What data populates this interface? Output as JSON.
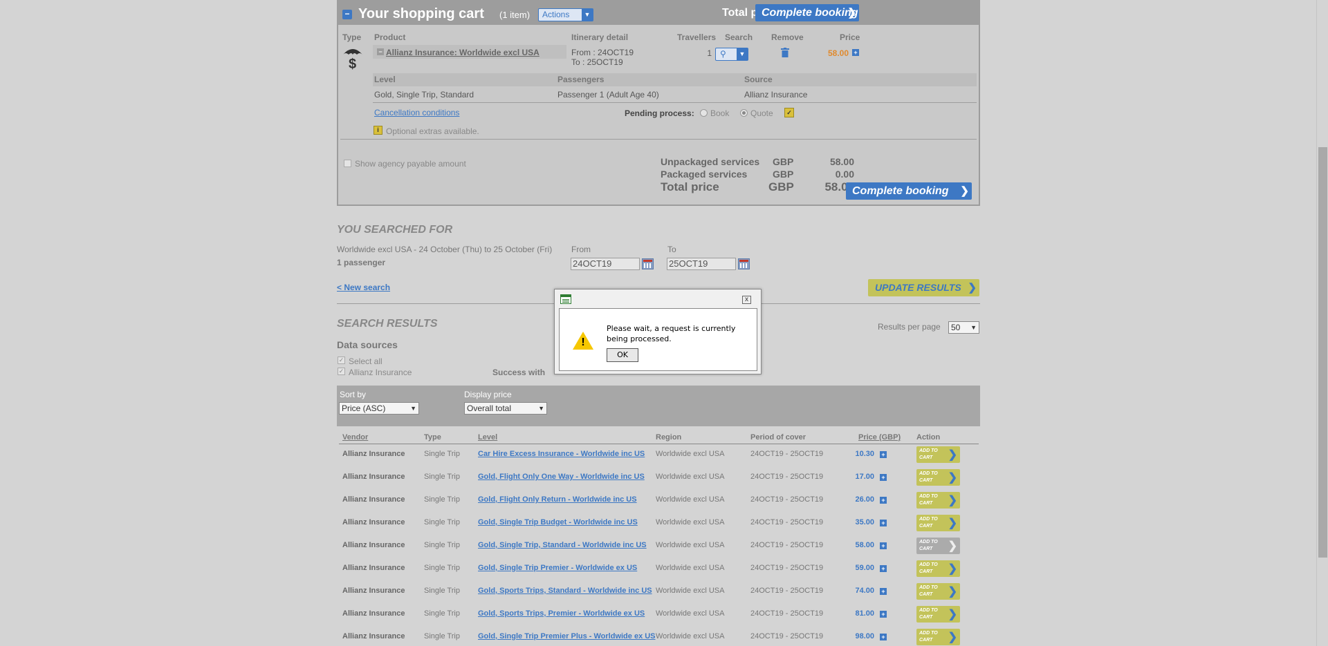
{
  "cart": {
    "collapse": "−",
    "title": "Your shopping cart",
    "count": "(1 item)",
    "actions_label": "Actions",
    "total": "Total price GBP 58.00",
    "complete_label": "Complete booking",
    "headers": {
      "type": "Type",
      "product": "Product",
      "itinerary": "Itinerary detail",
      "travellers": "Travellers",
      "search": "Search",
      "remove": "Remove",
      "price": "Price"
    },
    "item": {
      "product": "Allianz Insurance: Worldwide excl USA",
      "from": "From : 24OCT19",
      "to": "To : 25OCT19",
      "travellers": "1",
      "price": "58.00"
    },
    "sub_headers": {
      "level": "Level",
      "passengers": "Passengers",
      "source": "Source"
    },
    "sub_values": {
      "level": "Gold, Single Trip, Standard",
      "passengers": "Passenger 1 (Adult Age 40)",
      "source": "Allianz Insurance"
    },
    "cancellation": "Cancellation conditions",
    "pending_label": "Pending process:",
    "book_label": "Book",
    "quote_label": "Quote",
    "optional_extras": "Optional extras available.",
    "show_agency": "Show agency payable amount",
    "summary": {
      "unpackaged_label": "Unpackaged services",
      "unpackaged_cur": "GBP",
      "unpackaged_val": "58.00",
      "packaged_label": "Packaged services",
      "packaged_cur": "GBP",
      "packaged_val": "0.00",
      "total_label": "Total price",
      "total_cur": "GBP",
      "total_val": "58.00"
    }
  },
  "search": {
    "heading": "YOU SEARCHED FOR",
    "summary": "Worldwide excl USA - 24 October (Thu) to 25 October (Fri)",
    "passengers": "1 passenger",
    "from_label": "From",
    "from_value": "24OCT19",
    "to_label": "To",
    "to_value": "25OCT19",
    "new_search": "< New search",
    "update": "UPDATE RESULTS"
  },
  "results": {
    "heading": "SEARCH RESULTS",
    "per_page_label": "Results per page",
    "per_page_value": "50",
    "data_sources": "Data sources",
    "select_all": "Select all",
    "source_allianz": "Allianz Insurance",
    "success_text": "Success with info",
    "sort_label": "Sort by",
    "sort_value": "Price (ASC)",
    "display_label": "Display price",
    "display_value": "Overall total",
    "columns": {
      "vendor": "Vendor",
      "type": "Type",
      "level": "Level",
      "region": "Region",
      "period": "Period of cover",
      "price": "Price (GBP)",
      "action": "Action"
    },
    "add_label": "ADD TO CART",
    "rows": [
      {
        "vendor": "Allianz Insurance",
        "type": "Single Trip",
        "level": "Car Hire Excess Insurance - Worldwide inc US",
        "region": "Worldwide excl USA",
        "period": "24OCT19 - 25OCT19",
        "price": "10.30",
        "in_cart": false
      },
      {
        "vendor": "Allianz Insurance",
        "type": "Single Trip",
        "level": "Gold, Flight Only One Way - Worldwide inc US",
        "region": "Worldwide excl USA",
        "period": "24OCT19 - 25OCT19",
        "price": "17.00",
        "in_cart": false
      },
      {
        "vendor": "Allianz Insurance",
        "type": "Single Trip",
        "level": "Gold, Flight Only Return - Worldwide inc US",
        "region": "Worldwide excl USA",
        "period": "24OCT19 - 25OCT19",
        "price": "26.00",
        "in_cart": false
      },
      {
        "vendor": "Allianz Insurance",
        "type": "Single Trip",
        "level": "Gold, Single Trip Budget - Worldwide inc US",
        "region": "Worldwide excl USA",
        "period": "24OCT19 - 25OCT19",
        "price": "35.00",
        "in_cart": false
      },
      {
        "vendor": "Allianz Insurance",
        "type": "Single Trip",
        "level": "Gold, Single Trip, Standard - Worldwide inc US",
        "region": "Worldwide excl USA",
        "period": "24OCT19 - 25OCT19",
        "price": "58.00",
        "in_cart": true
      },
      {
        "vendor": "Allianz Insurance",
        "type": "Single Trip",
        "level": "Gold, Single Trip Premier - Worldwide ex US",
        "region": "Worldwide excl USA",
        "period": "24OCT19 - 25OCT19",
        "price": "59.00",
        "in_cart": false
      },
      {
        "vendor": "Allianz Insurance",
        "type": "Single Trip",
        "level": "Gold, Sports Trips, Standard - Worldwide inc US",
        "region": "Worldwide excl USA",
        "period": "24OCT19 - 25OCT19",
        "price": "74.00",
        "in_cart": false
      },
      {
        "vendor": "Allianz Insurance",
        "type": "Single Trip",
        "level": "Gold, Sports Trips, Premier - Worldwide ex US",
        "region": "Worldwide excl USA",
        "period": "24OCT19 - 25OCT19",
        "price": "81.00",
        "in_cart": false
      },
      {
        "vendor": "Allianz Insurance",
        "type": "Single Trip",
        "level": "Gold, Single Trip Premier Plus - Worldwide ex US",
        "region": "Worldwide excl USA",
        "period": "24OCT19 - 25OCT19",
        "price": "98.00",
        "in_cart": false
      }
    ]
  },
  "dialog": {
    "message": "Please wait, a request is currently being processed.",
    "ok": "OK",
    "close": "x"
  },
  "colors": {
    "accent": "#3d78c4",
    "add_button": "#c3c35a",
    "price_orange": "#e08a2e",
    "warning": "#f6c700"
  }
}
